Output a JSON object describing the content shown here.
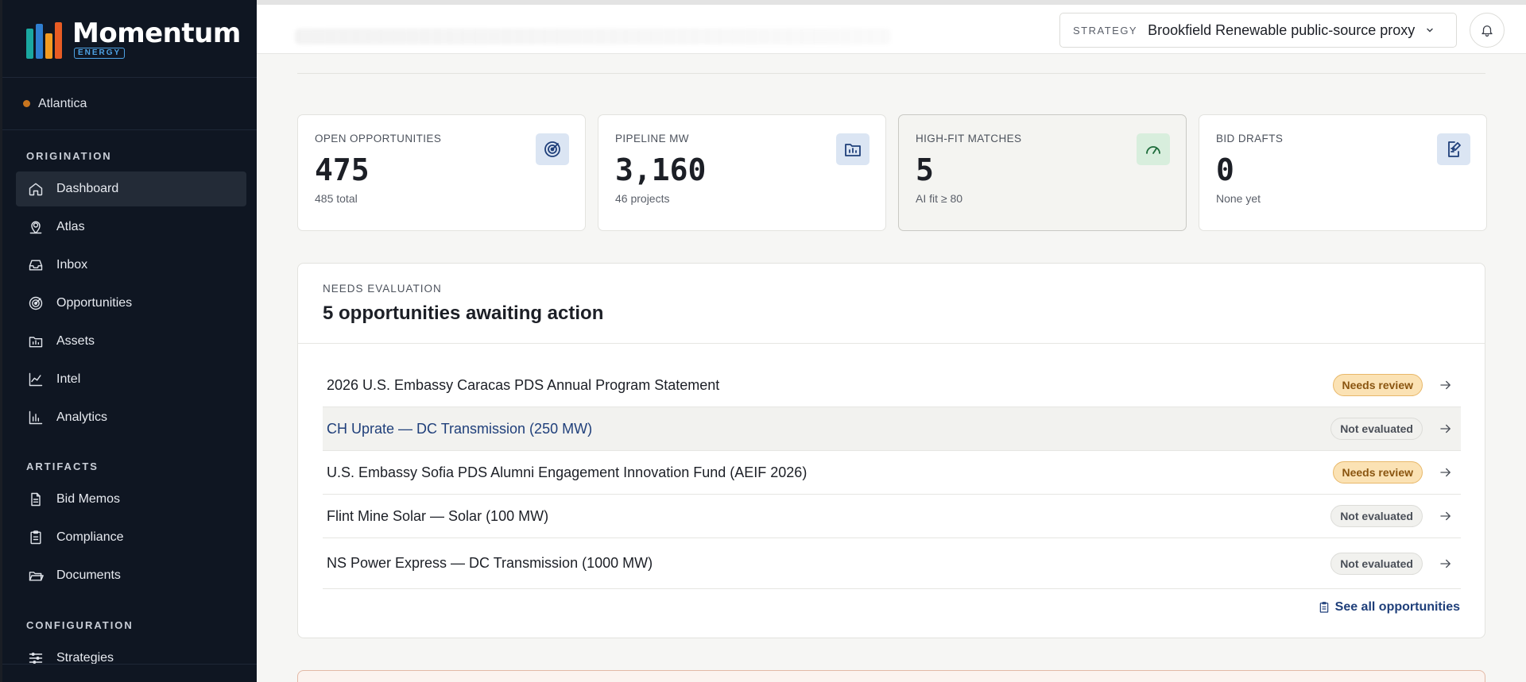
{
  "brand": {
    "name": "Momentum",
    "sub": "ENERGY"
  },
  "org": {
    "name": "Atlantica"
  },
  "nav": {
    "section_origination": "ORIGINATION",
    "section_artifacts": "ARTIFACTS",
    "section_configuration": "CONFIGURATION",
    "items": [
      {
        "label": "Dashboard",
        "icon": "home-icon"
      },
      {
        "label": "Atlas",
        "icon": "map-pin-icon"
      },
      {
        "label": "Inbox",
        "icon": "inbox-icon"
      },
      {
        "label": "Opportunities",
        "icon": "target-icon"
      },
      {
        "label": "Assets",
        "icon": "folder-chart-icon"
      },
      {
        "label": "Intel",
        "icon": "line-chart-icon"
      },
      {
        "label": "Analytics",
        "icon": "bar-chart-icon"
      },
      {
        "label": "Bid Memos",
        "icon": "document-icon"
      },
      {
        "label": "Compliance",
        "icon": "clipboard-icon"
      },
      {
        "label": "Documents",
        "icon": "folder-open-icon"
      },
      {
        "label": "Strategies",
        "icon": "sliders-icon"
      }
    ]
  },
  "topbar": {
    "strategy_label": "STRATEGY",
    "strategy_value": "Brookfield Renewable public-source proxy"
  },
  "kpis": [
    {
      "label": "OPEN OPPORTUNITIES",
      "value": "475",
      "sub": "485 total",
      "icon": "target-icon",
      "accent": "#dbe5f3"
    },
    {
      "label": "PIPELINE MW",
      "value": "3,160",
      "sub": "46 projects",
      "icon": "folder-chart-icon",
      "accent": "#dbe5f3"
    },
    {
      "label": "HIGH-FIT MATCHES",
      "value": "5",
      "sub": "AI fit ≥ 80",
      "icon": "gauge-icon",
      "accent": "#d8eedd"
    },
    {
      "label": "BID DRAFTS",
      "value": "0",
      "sub": "None yet",
      "icon": "edit-document-icon",
      "accent": "#dbe5f3"
    }
  ],
  "evaluation": {
    "eyebrow": "NEEDS EVALUATION",
    "title": "5 opportunities awaiting action",
    "rows": [
      {
        "title": "2026 U.S. Embassy Caracas PDS Annual Program Statement",
        "status": "Needs review"
      },
      {
        "title": "CH Uprate — DC Transmission (250 MW)",
        "status": "Not evaluated"
      },
      {
        "title": "U.S. Embassy Sofia PDS Alumni Engagement Innovation Fund (AEIF 2026)",
        "status": "Needs review"
      },
      {
        "title": "Flint Mine Solar — Solar (100 MW)",
        "status": "Not evaluated"
      },
      {
        "title": "NS Power Express — DC Transmission (1000 MW)",
        "status": "Not evaluated"
      }
    ],
    "see_all": "See all opportunities"
  }
}
